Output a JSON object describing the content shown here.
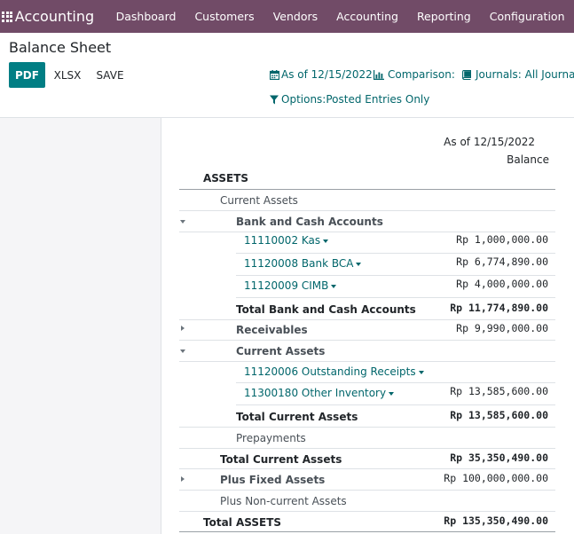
{
  "navbar": {
    "brand": "Accounting",
    "menu": [
      "Dashboard",
      "Customers",
      "Vendors",
      "Accounting",
      "Reporting",
      "Configuration"
    ]
  },
  "page": {
    "title": "Balance Sheet",
    "buttons": {
      "pdf": "PDF",
      "xlsx": "XLSX",
      "save": "SAVE"
    },
    "filters": {
      "date": "As of 12/15/2022",
      "comparison": "Comparison:",
      "journals": "Journals: All Journals",
      "options": "Options:Posted Entries Only"
    }
  },
  "report": {
    "column_date": "As of 12/15/2022",
    "column_label": "Balance",
    "rows": [
      {
        "label": "ASSETS",
        "amount": ""
      },
      {
        "label": "Current Assets",
        "amount": ""
      },
      {
        "label": "Bank and Cash Accounts",
        "amount": ""
      },
      {
        "label": "11110002 Kas",
        "amount": "Rp 1,000,000.00"
      },
      {
        "label": "11120008 Bank BCA",
        "amount": "Rp 6,774,890.00"
      },
      {
        "label": "11120009 CIMB",
        "amount": "Rp 4,000,000.00"
      },
      {
        "label": "Total Bank and Cash Accounts",
        "amount": "Rp 11,774,890.00"
      },
      {
        "label": "Receivables",
        "amount": "Rp 9,990,000.00"
      },
      {
        "label": "Current Assets",
        "amount": ""
      },
      {
        "label": "11120006 Outstanding Receipts",
        "amount": ""
      },
      {
        "label": "11300180 Other Inventory",
        "amount": "Rp 13,585,600.00"
      },
      {
        "label": "Total Current Assets",
        "amount": "Rp 13,585,600.00"
      },
      {
        "label": "Prepayments",
        "amount": ""
      },
      {
        "label": "Total Current Assets",
        "amount": "Rp 35,350,490.00"
      },
      {
        "label": "Plus Fixed Assets",
        "amount": "Rp 100,000,000.00"
      },
      {
        "label": "Plus Non-current Assets",
        "amount": ""
      },
      {
        "label": "Total ASSETS",
        "amount": "Rp 135,350,490.00"
      }
    ]
  }
}
